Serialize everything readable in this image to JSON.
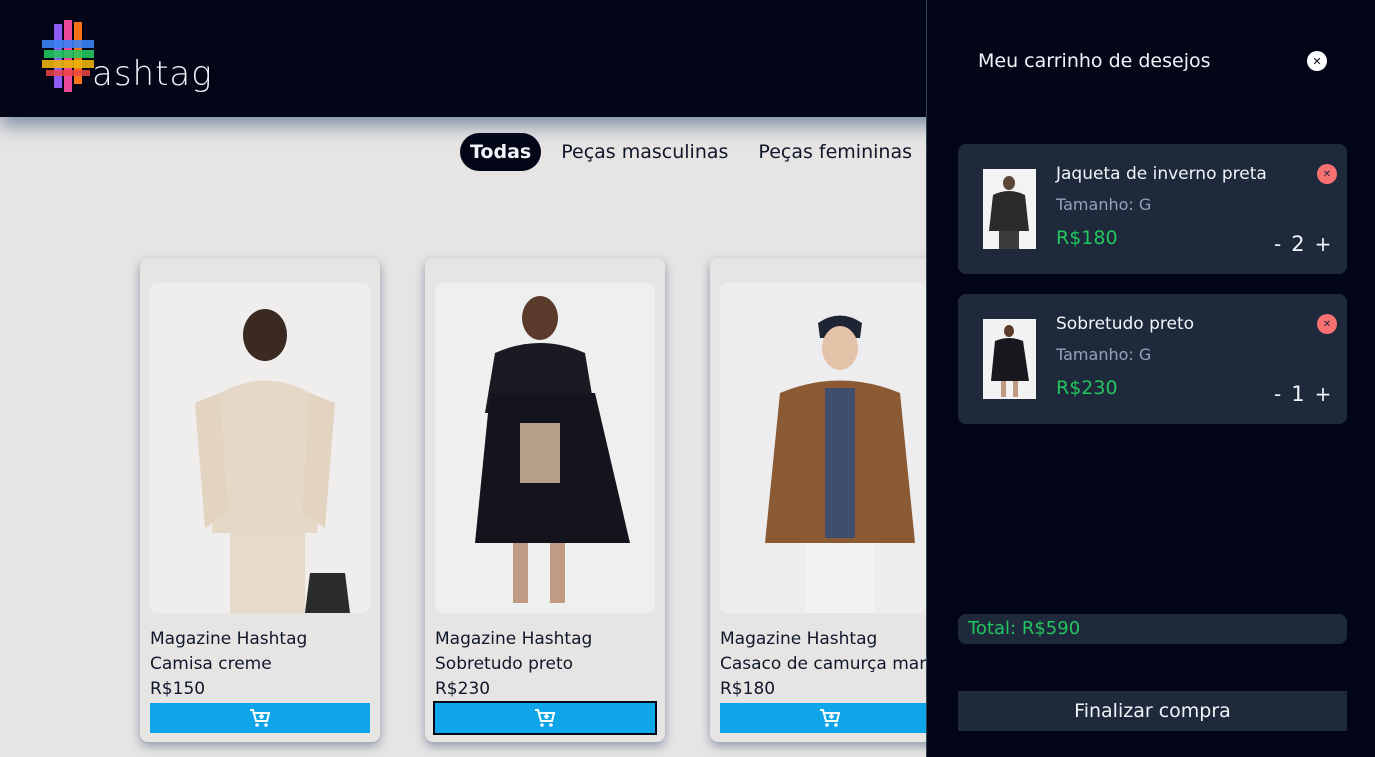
{
  "header": {
    "logo_text": "ashtag"
  },
  "filters": [
    {
      "label": "Todas",
      "active": true
    },
    {
      "label": "Peças masculinas",
      "active": false
    },
    {
      "label": "Peças femininas",
      "active": false
    }
  ],
  "products": [
    {
      "brand": "Magazine Hashtag",
      "name": "Camisa creme",
      "price": "R$150"
    },
    {
      "brand": "Magazine Hashtag",
      "name": "Sobretudo preto",
      "price": "R$230"
    },
    {
      "brand": "Magazine Hashtag",
      "name": "Casaco de camurça marrom",
      "price": "R$180"
    }
  ],
  "cart": {
    "title": "Meu carrinho de desejos",
    "items": [
      {
        "name": "Jaqueta de inverno preta",
        "size": "Tamanho: G",
        "price": "R$180",
        "qty": "2"
      },
      {
        "name": "Sobretudo preto",
        "size": "Tamanho: G",
        "price": "R$230",
        "qty": "1"
      }
    ],
    "total": "Total: R$590",
    "checkout_label": "Finalizar compra",
    "minus": "-",
    "plus": "+"
  },
  "colors": {
    "header_bg": "#020617",
    "accent": "#0ea5e9",
    "price_green": "#22c55e",
    "remove_red": "#f87171"
  },
  "icons": {
    "cart_add": "cart-plus-icon",
    "close": "close-icon",
    "remove": "remove-icon"
  }
}
